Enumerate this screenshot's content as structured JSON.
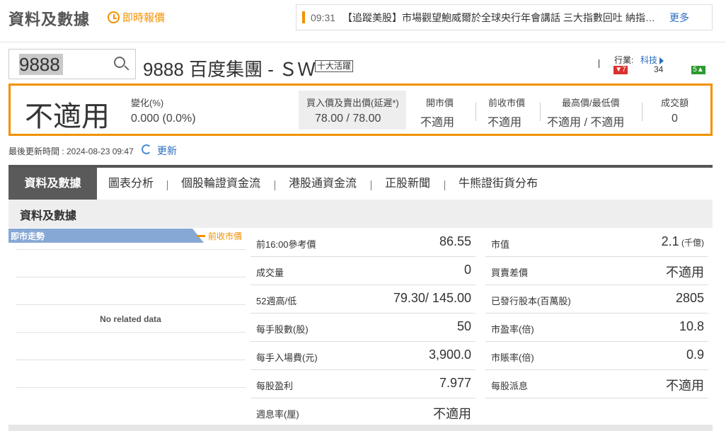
{
  "header": {
    "title": "資料及數據",
    "realtime_label": "即時報價"
  },
  "ticker": {
    "time": "09:31",
    "headline": "【追蹤美股】市場觀望鮑威爾於全球央行年會講話 三大指數回吐 納指…",
    "more_label": "更多"
  },
  "search": {
    "value": "9888"
  },
  "stock": {
    "name": "9888 百度集團 - ＳＷ",
    "badge": "十大活躍"
  },
  "industry": {
    "label": "行業:",
    "value": "科技",
    "down_count": "7",
    "flat_count": "34",
    "up_count": "5"
  },
  "quote": {
    "price": "不適用",
    "change_label": "變化(%)",
    "change_value": "0.000 (0.0%)",
    "bidask_label": "買入價及賣出價(延遲*)",
    "bidask_value": "78.00 / 78.00",
    "open_label": "開市價",
    "open_value": "不適用",
    "prev_close_label": "前收市價",
    "prev_close_value": "不適用",
    "high_low_label": "最高價/最低價",
    "high_low_value": "不適用 / 不適用",
    "turnover_label": "成交額",
    "turnover_value": "0"
  },
  "update": {
    "last_updated": "最後更新時間 : 2024-08-23 09:47",
    "refresh_label": "更新"
  },
  "tabs": [
    {
      "label": "資料及數據"
    },
    {
      "label": "圖表分析"
    },
    {
      "label": "個股輪證資金流"
    },
    {
      "label": "港股通資金流"
    },
    {
      "label": "正股新聞"
    },
    {
      "label": "牛熊證街貨分布"
    }
  ],
  "section": {
    "title": "資料及數據"
  },
  "chart": {
    "title": "即市走勢",
    "legend_prev_close": "前收市價",
    "no_data": "No related data"
  },
  "left_stats": [
    {
      "label": "前16:00參考價",
      "value": "86.55"
    },
    {
      "label": "成交量",
      "value": "0"
    },
    {
      "label": "52週高/低",
      "value": "79.30/ 145.00"
    },
    {
      "label": "每手股數(股)",
      "value": "50"
    },
    {
      "label": "每手入場費(元)",
      "value": "3,900.0"
    },
    {
      "label": "每股盈利",
      "value": "7.977"
    },
    {
      "label": "週息率(厘)",
      "value": "不適用"
    }
  ],
  "right_stats": [
    {
      "label": "市值",
      "value": "2.1",
      "unit": " (千億)"
    },
    {
      "label": "買賣差價",
      "value": "不適用"
    },
    {
      "label": "已發行股本(百萬股)",
      "value": "2805"
    },
    {
      "label": "市盈率(倍)",
      "value": "10.8"
    },
    {
      "label": "市賬率(倍)",
      "value": "0.9"
    },
    {
      "label": "每股派息",
      "value": "不適用"
    }
  ],
  "colors": {
    "accent": "#f29100",
    "link": "#2a6cc0",
    "up": "#2d9a2f",
    "down": "#d9322e"
  }
}
